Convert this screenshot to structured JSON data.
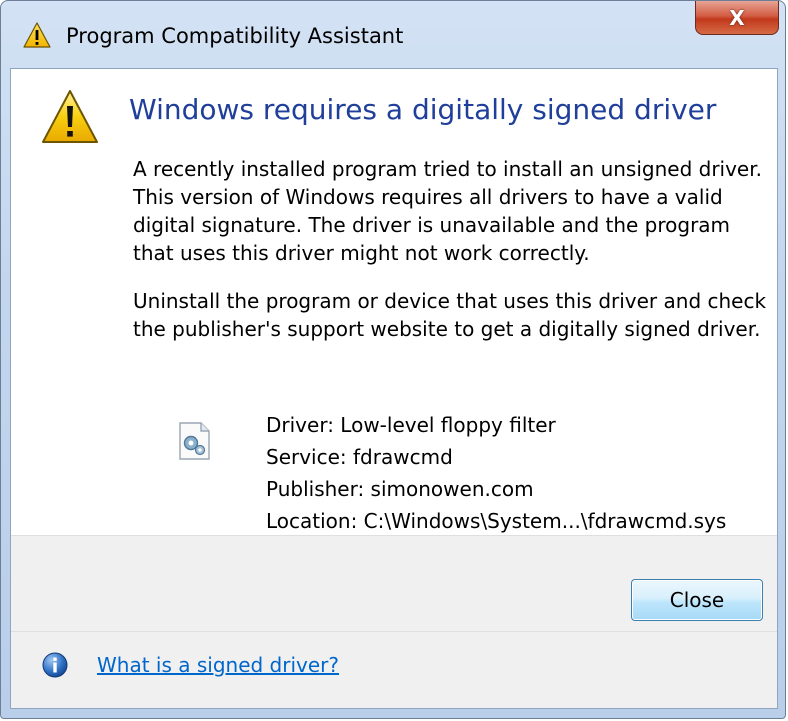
{
  "window": {
    "title": "Program Compatibility Assistant",
    "close_glyph": "X"
  },
  "main": {
    "heading": "Windows requires a digitally signed driver",
    "paragraph1": "A recently installed program tried to install an unsigned driver. This version of Windows requires all drivers to have a valid digital signature. The driver is unavailable and the program that uses this driver might not work correctly.",
    "paragraph2": "Uninstall the program or device that uses this driver and check the publisher's support website to get a digitally signed driver.",
    "details": {
      "driver": "Driver: Low-level floppy filter",
      "service": "Service: fdrawcmd",
      "publisher": "Publisher: simonowen.com",
      "location": "Location: C:\\Windows\\System...\\fdrawcmd.sys"
    }
  },
  "buttons": {
    "close_label": "Close"
  },
  "footer": {
    "help_link": "What is a signed driver?"
  },
  "icons": {
    "title": "warning-icon",
    "main": "warning-icon",
    "driver": "driver-file-icon",
    "help": "info-icon"
  },
  "colors": {
    "heading": "#1f3f9a",
    "link": "#0066cc",
    "warning_yellow": "#f5c400"
  }
}
